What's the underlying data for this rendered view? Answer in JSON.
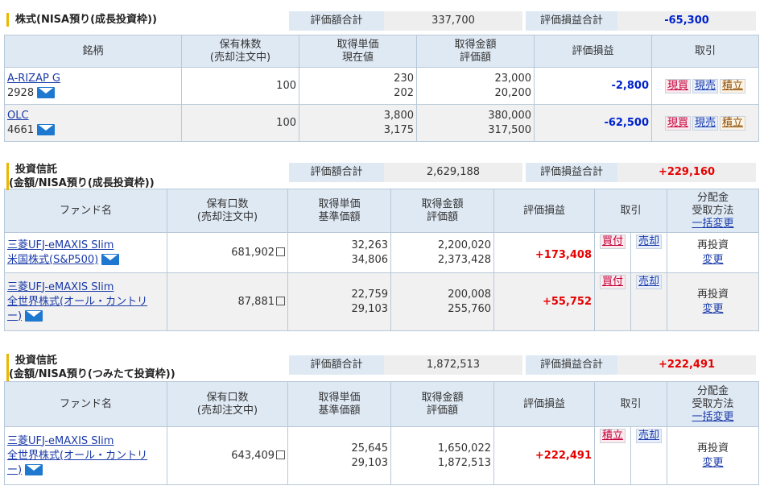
{
  "stock": {
    "title": "株式(NISA預り(成長投資枠))",
    "eval_total_label": "評価額合計",
    "eval_total": "337,700",
    "pl_total_label": "評価損益合計",
    "pl_total": "-65,300",
    "headers": {
      "name": "銘柄",
      "qty1": "保有株数",
      "qty2": "(売却注文中)",
      "cost1": "取得単価",
      "cost2": "現在値",
      "amt1": "取得金額",
      "amt2": "評価額",
      "pl": "評価損益",
      "trade": "取引"
    },
    "rows": [
      {
        "name": "A-RIZAP G",
        "code": "2928",
        "qty": "100",
        "cost": "230",
        "price": "202",
        "amount": "23,000",
        "value": "20,200",
        "pl": "-2,800",
        "buy": "現買",
        "sell": "現売",
        "accum": "積立"
      },
      {
        "name": "OLC",
        "code": "4661",
        "qty": "100",
        "cost": "3,800",
        "price": "3,175",
        "amount": "380,000",
        "value": "317,500",
        "pl": "-62,500",
        "buy": "現買",
        "sell": "現売",
        "accum": "積立"
      }
    ]
  },
  "fund1": {
    "title1": "投資信託",
    "title2": "(金額/NISA預り(成長投資枠))",
    "eval_total_label": "評価額合計",
    "eval_total": "2,629,188",
    "pl_total_label": "評価損益合計",
    "pl_total": "+229,160",
    "headers": {
      "name": "ファンド名",
      "qty1": "保有口数",
      "qty2": "(売却注文中)",
      "cost1": "取得単価",
      "cost2": "基準価額",
      "amt1": "取得金額",
      "amt2": "評価額",
      "pl": "評価損益",
      "trade": "取引",
      "div1": "分配金",
      "div2": "受取方法",
      "div3": "一括変更"
    },
    "rows": [
      {
        "name1": "三菱UFJ-eMAXIS Slim",
        "name2": "米国株式(S&P500)",
        "name3": "",
        "qty": "681,902",
        "cost": "32,263",
        "nav": "34,806",
        "amount": "2,200,020",
        "value": "2,373,428",
        "pl": "+173,408",
        "buy": "買付",
        "sell": "売却",
        "div": "再投資",
        "change": "変更"
      },
      {
        "name1": "三菱UFJ-eMAXIS Slim",
        "name2": "全世界株式(オール・カントリ",
        "name3": "ー)",
        "qty": "87,881",
        "cost": "22,759",
        "nav": "29,103",
        "amount": "200,008",
        "value": "255,760",
        "pl": "+55,752",
        "buy": "買付",
        "sell": "売却",
        "div": "再投資",
        "change": "変更"
      }
    ]
  },
  "fund2": {
    "title1": "投資信託",
    "title2": "(金額/NISA預り(つみたて投資枠))",
    "eval_total_label": "評価額合計",
    "eval_total": "1,872,513",
    "pl_total_label": "評価損益合計",
    "pl_total": "+222,491",
    "headers": {
      "name": "ファンド名",
      "qty1": "保有口数",
      "qty2": "(売却注文中)",
      "cost1": "取得単価",
      "cost2": "基準価額",
      "amt1": "取得金額",
      "amt2": "評価額",
      "pl": "評価損益",
      "trade": "取引",
      "div1": "分配金",
      "div2": "受取方法",
      "div3": "一括変更"
    },
    "rows": [
      {
        "name1": "三菱UFJ-eMAXIS Slim",
        "name2": "全世界株式(オール・カントリ",
        "name3": "ー)",
        "qty": "643,409",
        "cost": "25,645",
        "nav": "29,103",
        "amount": "1,650,022",
        "value": "1,872,513",
        "pl": "+222,491",
        "buy": "積立",
        "sell": "売却",
        "div": "再投資",
        "change": "変更"
      }
    ]
  },
  "icons": {
    "mail": "mail-icon",
    "checkbox": "checkbox-square-icon"
  }
}
